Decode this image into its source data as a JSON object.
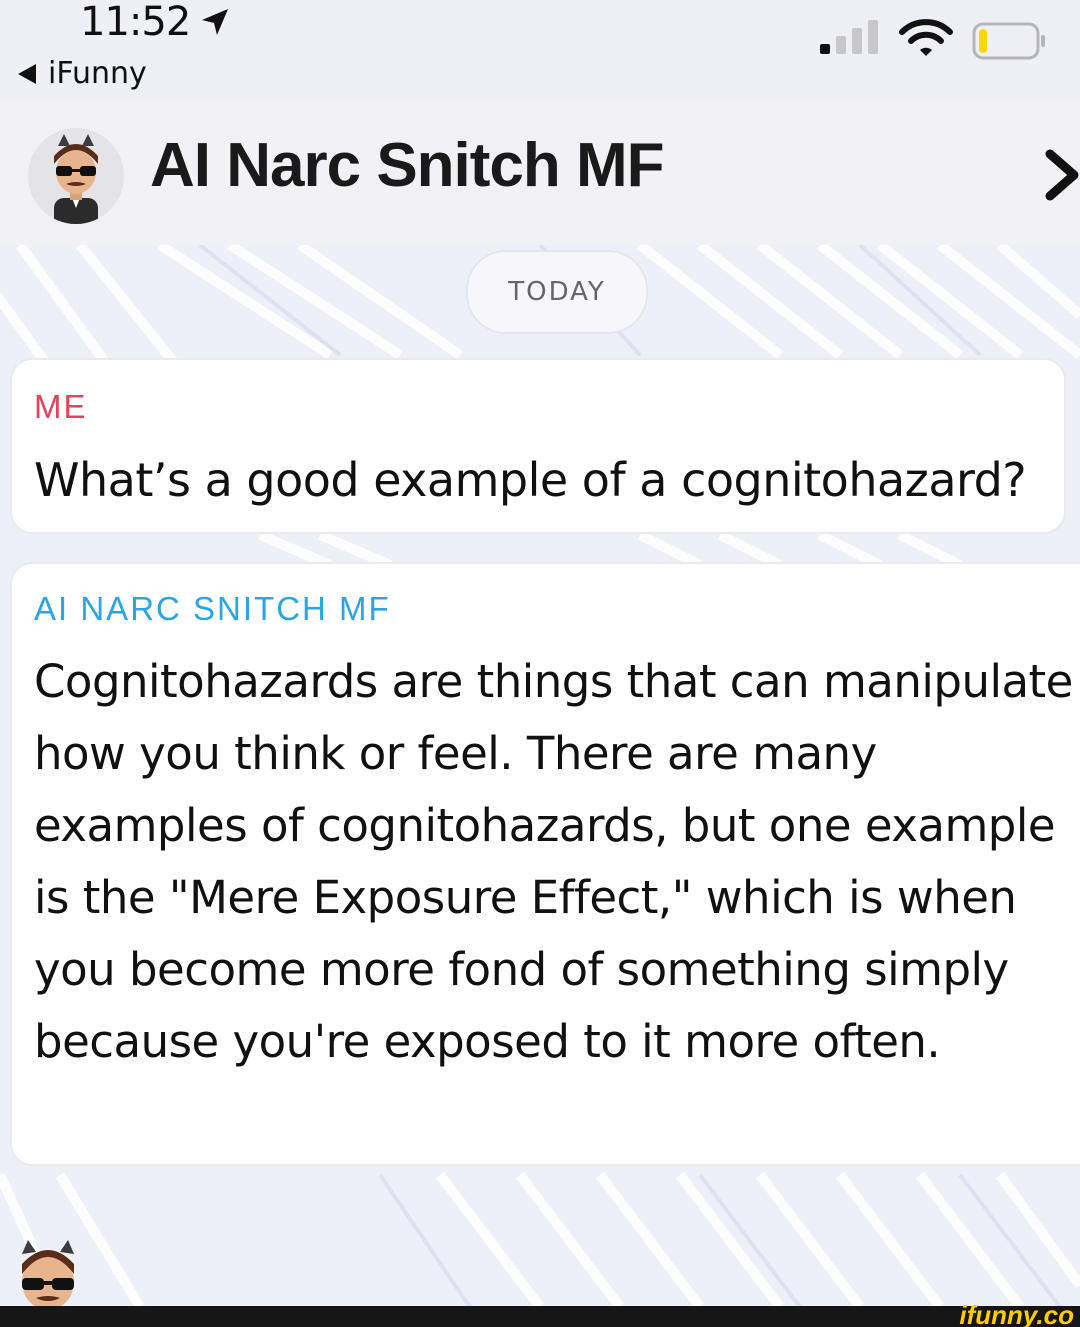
{
  "status_bar": {
    "time": "11:52",
    "back_app": "iFunny"
  },
  "header": {
    "title": "AI Narc Snitch MF"
  },
  "divider": {
    "date_label": "TODAY"
  },
  "messages": [
    {
      "sender": "ME",
      "text": "What’s a good example of a cognitohazard?"
    },
    {
      "sender": "AI NARC SNITCH MF",
      "text": "Cognitohazards are things that can manipulate how you think or feel. There are many examples of cognitohazards, but one example is the \"Mere Exposure Effect,\" which is when you become more fond of something simply because you're exposed to it more often."
    }
  ],
  "colors": {
    "me_sender": "#e3445b",
    "ai_sender": "#2aa6e6",
    "battery_level": "#ffd60a"
  },
  "battery_fraction": 0.15,
  "watermark": "ifunny.co"
}
